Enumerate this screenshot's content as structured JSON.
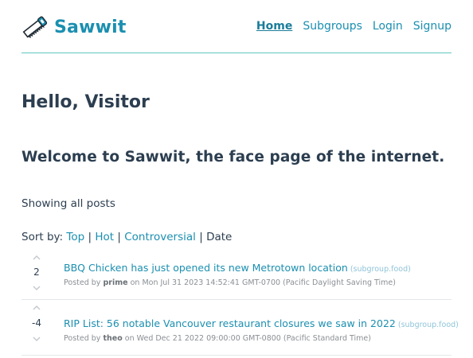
{
  "header": {
    "brand": "Sawwit",
    "logo_icon": "saw-icon",
    "nav": [
      {
        "label": "Home",
        "active": true
      },
      {
        "label": "Subgroups",
        "active": false
      },
      {
        "label": "Login",
        "active": false
      },
      {
        "label": "Signup",
        "active": false
      }
    ]
  },
  "main": {
    "greeting": "Hello, Visitor",
    "welcome": "Welcome to Sawwit, the face page of the internet.",
    "showing": "Showing all posts",
    "sort": {
      "prefix": "Sort by:",
      "options": [
        "Top",
        "Hot",
        "Controversial"
      ],
      "current": "Date",
      "separator": "|"
    }
  },
  "posts": [
    {
      "score": "2",
      "title": "BBQ Chicken has just opened its new Metrotown location",
      "subgroup": "(subgroup.food)",
      "posted_by_prefix": "Posted by",
      "author": "prime",
      "date_text": "on Mon Jul 31 2023 14:52:41 GMT-0700 (Pacific Daylight Saving Time)"
    },
    {
      "score": "-4",
      "title": "RIP List: 56 notable Vancouver restaurant closures we saw in 2022",
      "subgroup": "(subgroup.food)",
      "posted_by_prefix": "Posted by",
      "author": "theo",
      "date_text": "on Wed Dec 21 2022 09:00:00 GMT-0800 (Pacific Standard Time)"
    }
  ],
  "colors": {
    "accent": "#1b8fb0",
    "divider": "#5fc7bf",
    "text": "#2c3e50"
  }
}
